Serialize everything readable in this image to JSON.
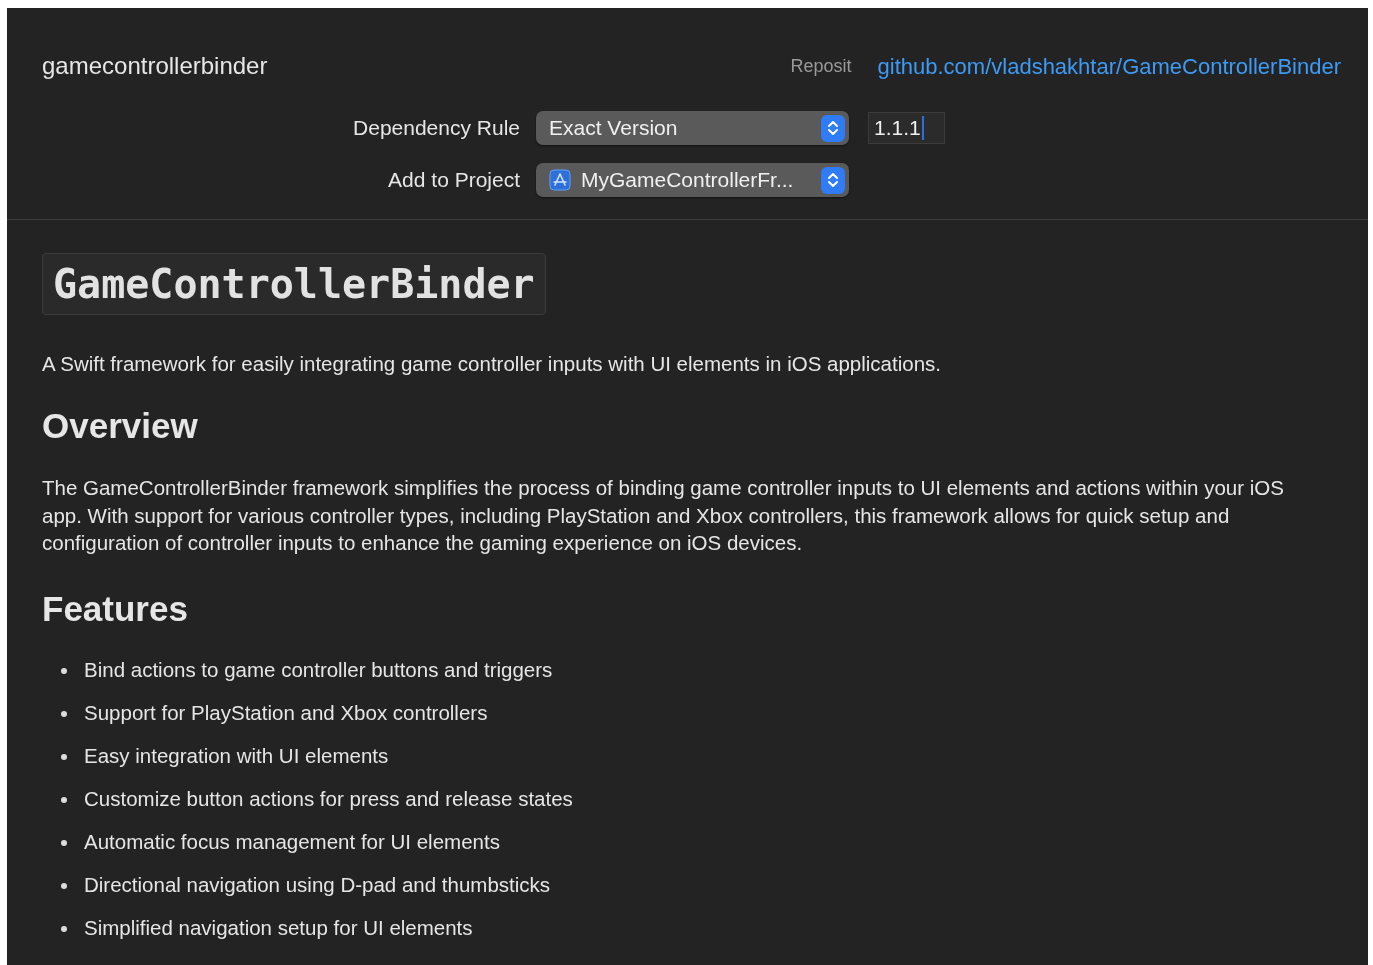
{
  "header": {
    "package_name": "gamecontrollerbinder",
    "repository_label": "Reposit",
    "repository_link": "github.com/vladshakhtar/GameControllerBinder"
  },
  "form": [
    {
      "kind": "version",
      "label": "Dependency Rule",
      "value": "Exact Version",
      "version_field": {
        "value": "1.1.1",
        "focused": true
      }
    },
    {
      "kind": "project",
      "label": "Add to Project",
      "value": "MyGameControllerFr..."
    }
  ],
  "readme": {
    "title": "GameControllerBinder",
    "summary": "A Swift framework for easily integrating game controller inputs with UI elements in iOS applications.",
    "sections": [
      {
        "heading": "Overview",
        "paragraph": "The GameControllerBinder framework simplifies the process of binding game controller inputs to UI elements and actions within your iOS app. With support for various controller types, including PlayStation and Xbox controllers, this framework allows for quick setup and configuration of controller inputs to enhance the gaming experience on iOS devices."
      },
      {
        "heading": "Features",
        "bullets": [
          "Bind actions to game controller buttons and triggers",
          "Support for PlayStation and Xbox controllers",
          "Easy integration with UI elements",
          "Customize button actions for press and release states",
          "Automatic focus management for UI elements",
          "Directional navigation using D-pad and thumbsticks",
          "Simplified navigation setup for UI elements"
        ]
      }
    ]
  }
}
